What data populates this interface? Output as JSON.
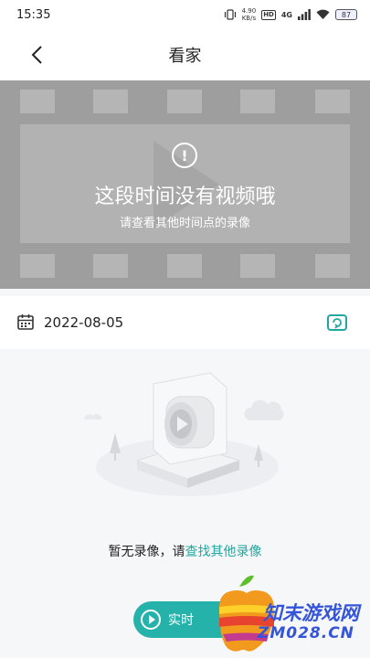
{
  "status_bar": {
    "time": "15:35",
    "speed_value": "4.90",
    "speed_unit": "KB/s",
    "hd_label": "HD",
    "network_label": "4G",
    "battery_level": "87"
  },
  "header": {
    "title": "看家",
    "back_icon": "chevron-left-icon"
  },
  "video": {
    "message": "这段时间没有视频哦",
    "sub_message": "请查看其他时间点的录像",
    "alert_symbol": "!"
  },
  "date_bar": {
    "date": "2022-08-05",
    "calendar_icon": "calendar-icon",
    "switch_icon": "switch-view-icon"
  },
  "empty_state": {
    "text_prefix": "暂无录像，请",
    "link_text": "查找其他录像",
    "live_button_label": "实时"
  },
  "watermark": {
    "name": "知末游戏网",
    "url": "ZM028.CN"
  },
  "colors": {
    "accent": "#24b2aa",
    "link": "#20a7a0",
    "video_bg": "#9e9e9e"
  }
}
